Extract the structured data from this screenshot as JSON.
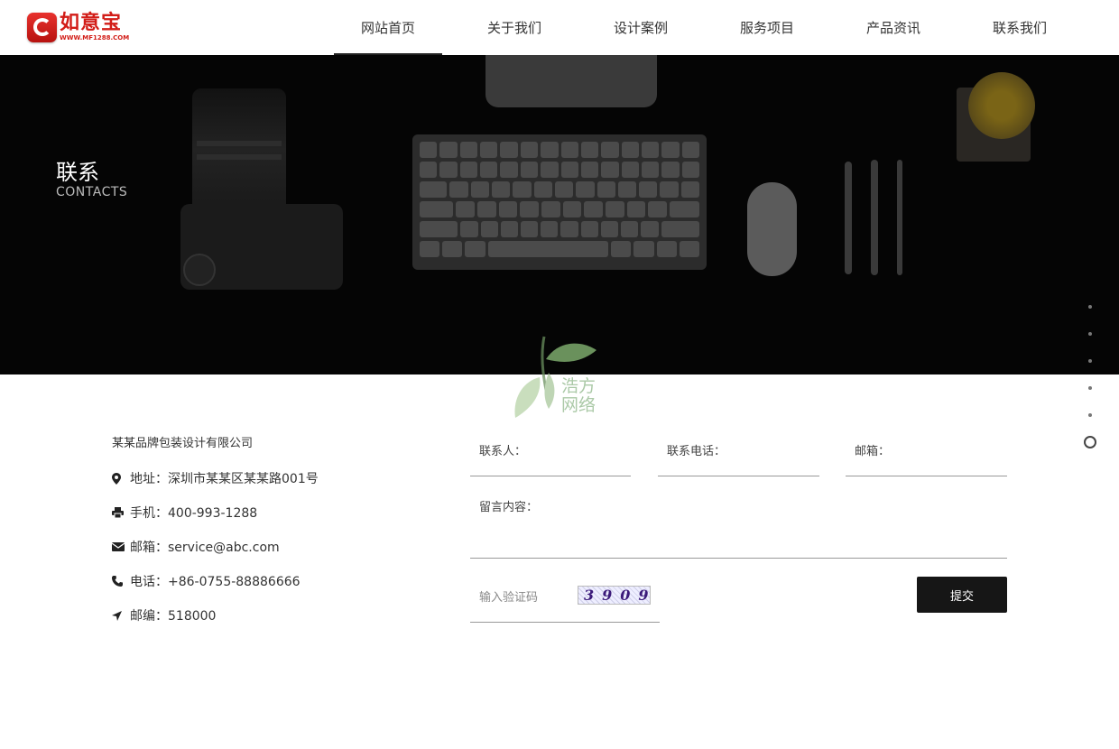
{
  "logo": {
    "brand": "如意宝",
    "url_text": "WWW.MF1288.COM"
  },
  "nav": {
    "items": [
      {
        "label": "网站首页"
      },
      {
        "label": "关于我们"
      },
      {
        "label": "设计案例"
      },
      {
        "label": "服务项目"
      },
      {
        "label": "产品资讯"
      },
      {
        "label": "联系我们"
      }
    ],
    "active": "网站首页"
  },
  "banner": {
    "title": "联系",
    "subtitle": "CONTACTS"
  },
  "watermark": {
    "line1": "浩方",
    "line2": "网络"
  },
  "contact": {
    "company": "某某品牌包装设计有限公司",
    "address": "地址：深圳市某某区某某路001号",
    "mobile": "手机：400-993-1288",
    "email": "邮箱：service@abc.com",
    "phone": "电话：+86-0755-88886666",
    "postcode": "邮编：518000"
  },
  "form": {
    "contact_person_label": "联系人：",
    "phone_label": "联系电话：",
    "email_label": "邮箱：",
    "message_label": "留言内容：",
    "captcha_placeholder": "输入验证码",
    "captcha_code": "3909",
    "submit_label": "提交"
  },
  "side_nav": {
    "dot_count": 5,
    "active_index": 5
  },
  "colors": {
    "brand_red": "#d21c17",
    "banner_bg": "#050505",
    "button_bg": "#161616"
  }
}
